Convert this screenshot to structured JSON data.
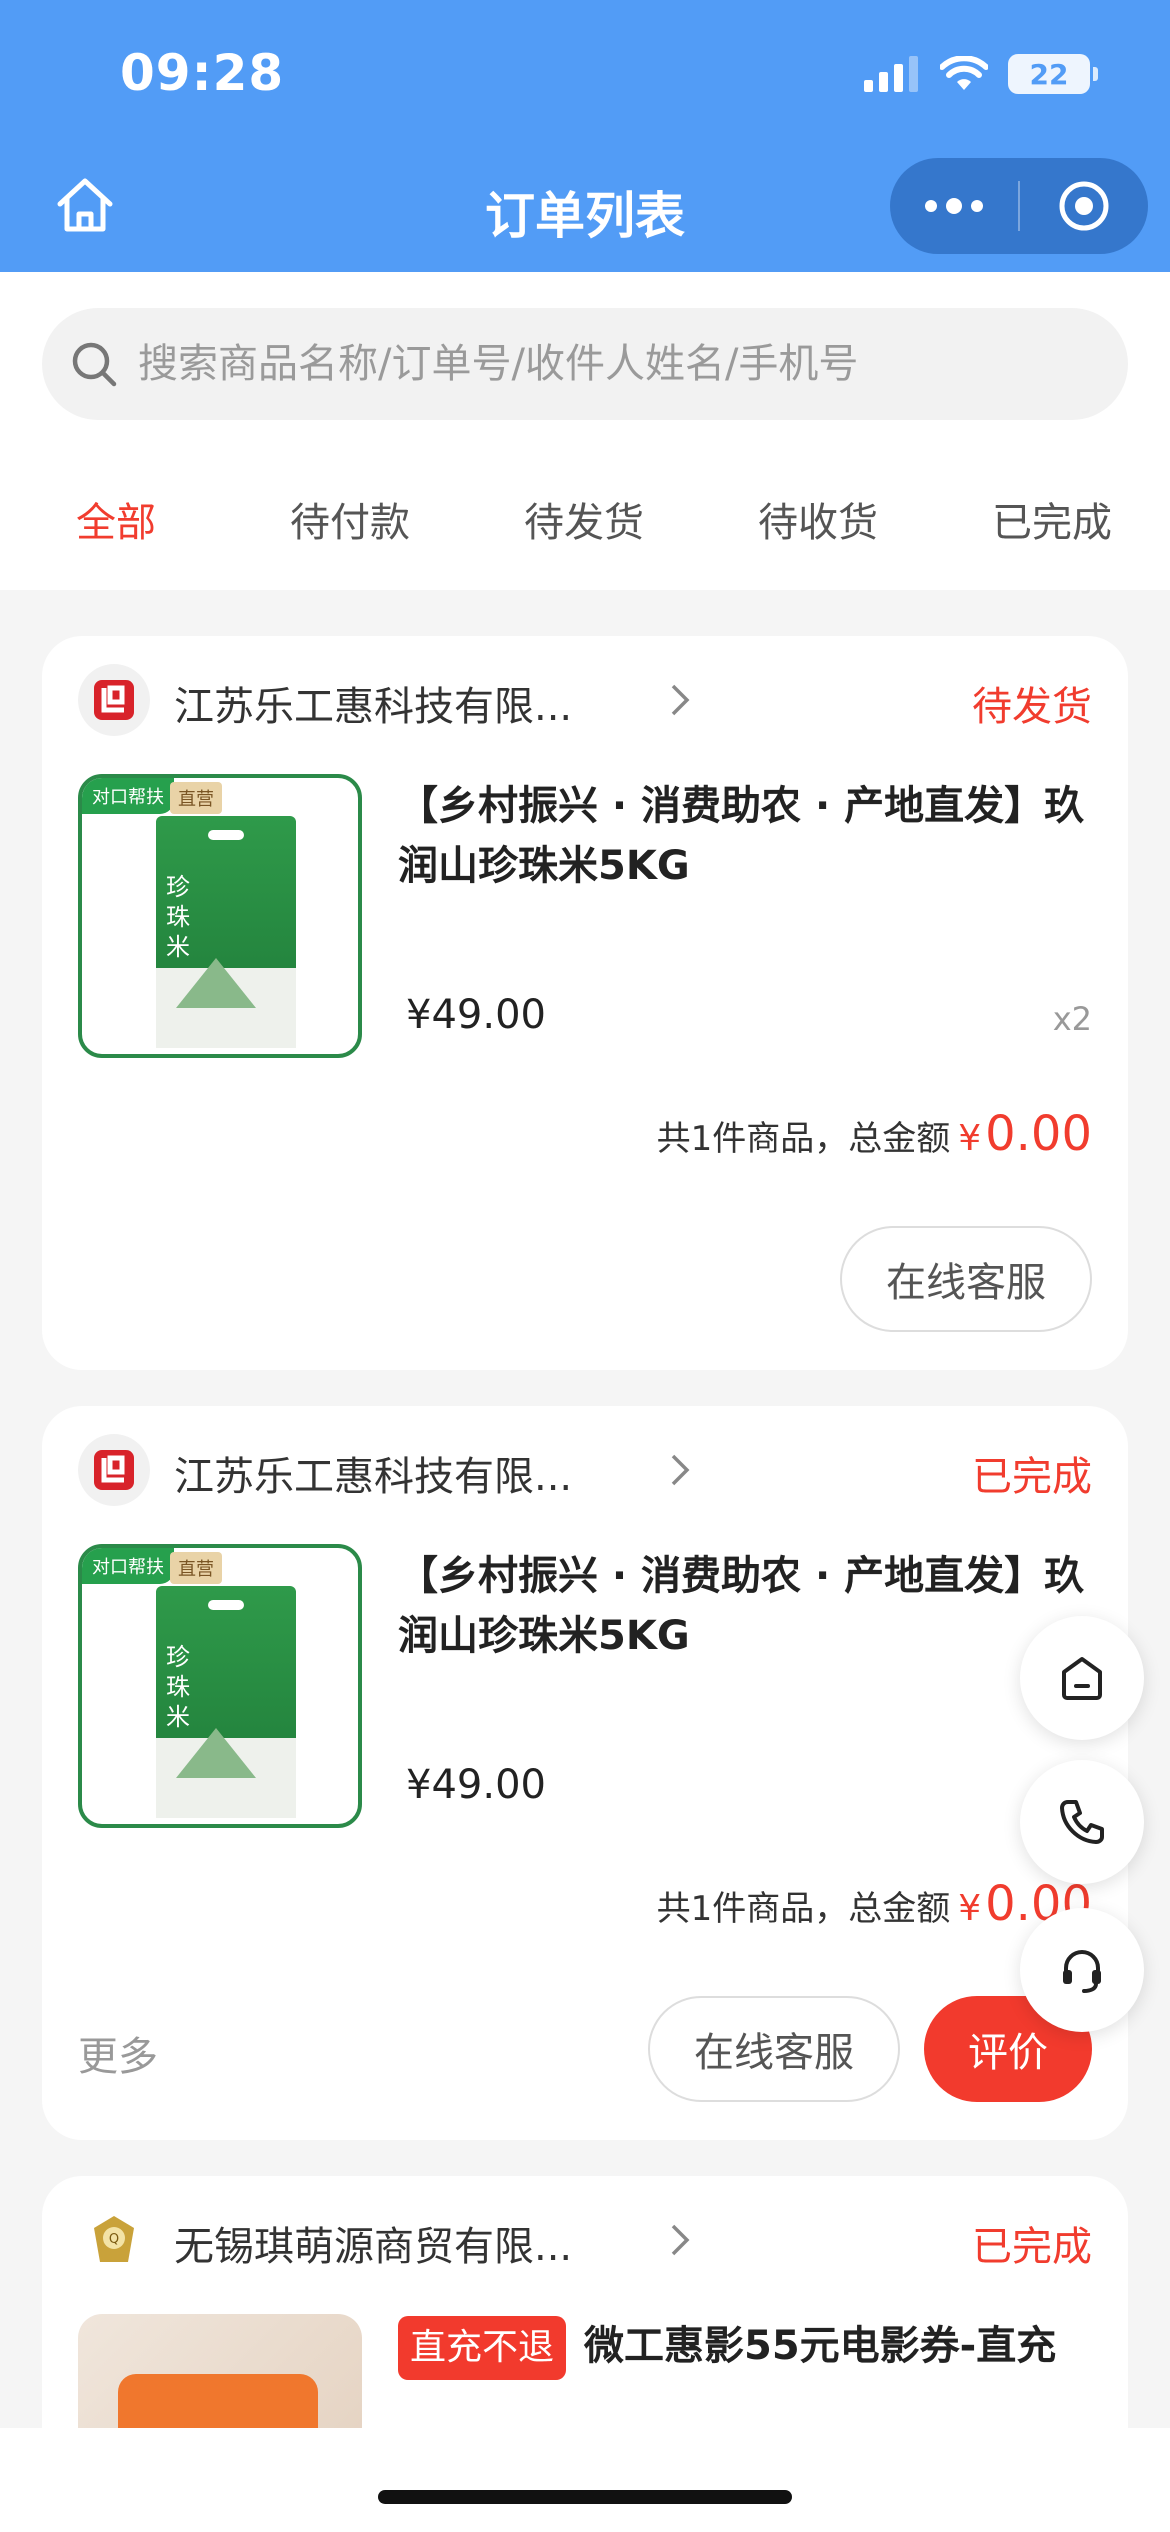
{
  "status_bar": {
    "time": "09:28",
    "battery": "22"
  },
  "header": {
    "title": "订单列表"
  },
  "search": {
    "placeholder": "搜索商品名称/订单号/收件人姓名/手机号"
  },
  "tabs": [
    {
      "label": "全部",
      "active": true
    },
    {
      "label": "待付款"
    },
    {
      "label": "待发货"
    },
    {
      "label": "待收货"
    },
    {
      "label": "已完成"
    }
  ],
  "orders": [
    {
      "store": "江苏乐工惠科技有限...",
      "status": "待发货",
      "tag1": "对口帮扶",
      "tag2": "直营",
      "bag_text": "珍珠米",
      "product_title": "【乡村振兴 · 消费助农 · 产地直发】玖润山珍珠米5KG",
      "price": "¥49.00",
      "qty": "x2",
      "summary_label": "共1件商品，总金额",
      "currency": "¥",
      "total": "0.00",
      "btn_service": "在线客服"
    },
    {
      "store": "江苏乐工惠科技有限...",
      "status": "已完成",
      "tag1": "对口帮扶",
      "tag2": "直营",
      "bag_text": "珍珠米",
      "product_title": "【乡村振兴 · 消费助农 · 产地直发】玖润山珍珠米5KG",
      "price": "¥49.00",
      "summary_label": "共1件商品，总金额",
      "currency": "¥",
      "total": "0.00",
      "more": "更多",
      "btn_service": "在线客服",
      "btn_review": "评价"
    },
    {
      "store": "无锡琪萌源商贸有限...",
      "status": "已完成",
      "product_tag": "直充不退",
      "product_title": "微工惠影55元电影券-直充"
    }
  ],
  "colors": {
    "header_bg": "#529cf6",
    "accent_red": "#f13c2e",
    "page_bg": "#f5f5f5"
  }
}
